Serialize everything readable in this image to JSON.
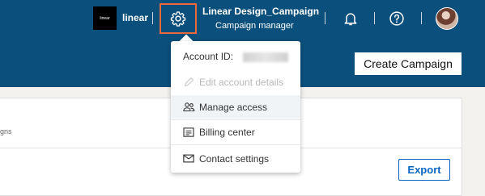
{
  "topbar": {
    "account_logo_text": "linear",
    "account_name": "linear",
    "campaign_title": "Linear Design_Campaign",
    "campaign_subtitle": "Campaign manager"
  },
  "icons": {
    "settings": "gear-icon",
    "notifications": "bell-icon",
    "help": "help-circle-icon",
    "avatar": "user-avatar"
  },
  "dropdown": {
    "account_id_label": "Account ID:",
    "items": [
      {
        "label": "Edit account details",
        "icon": "pencil-icon",
        "disabled": true
      },
      {
        "label": "Manage access",
        "icon": "people-icon",
        "disabled": false,
        "hovered": true
      },
      {
        "label": "Billing center",
        "icon": "billing-icon",
        "disabled": false
      },
      {
        "label": "Contact settings",
        "icon": "envelope-icon",
        "disabled": false
      }
    ]
  },
  "actions": {
    "create_campaign": "Create Campaign",
    "export": "Export"
  },
  "content": {
    "snippet_text": "gns"
  },
  "colors": {
    "nav_bg": "#0b4f7c",
    "highlight_border": "#e86a3a",
    "link_blue": "#0a66c2"
  }
}
